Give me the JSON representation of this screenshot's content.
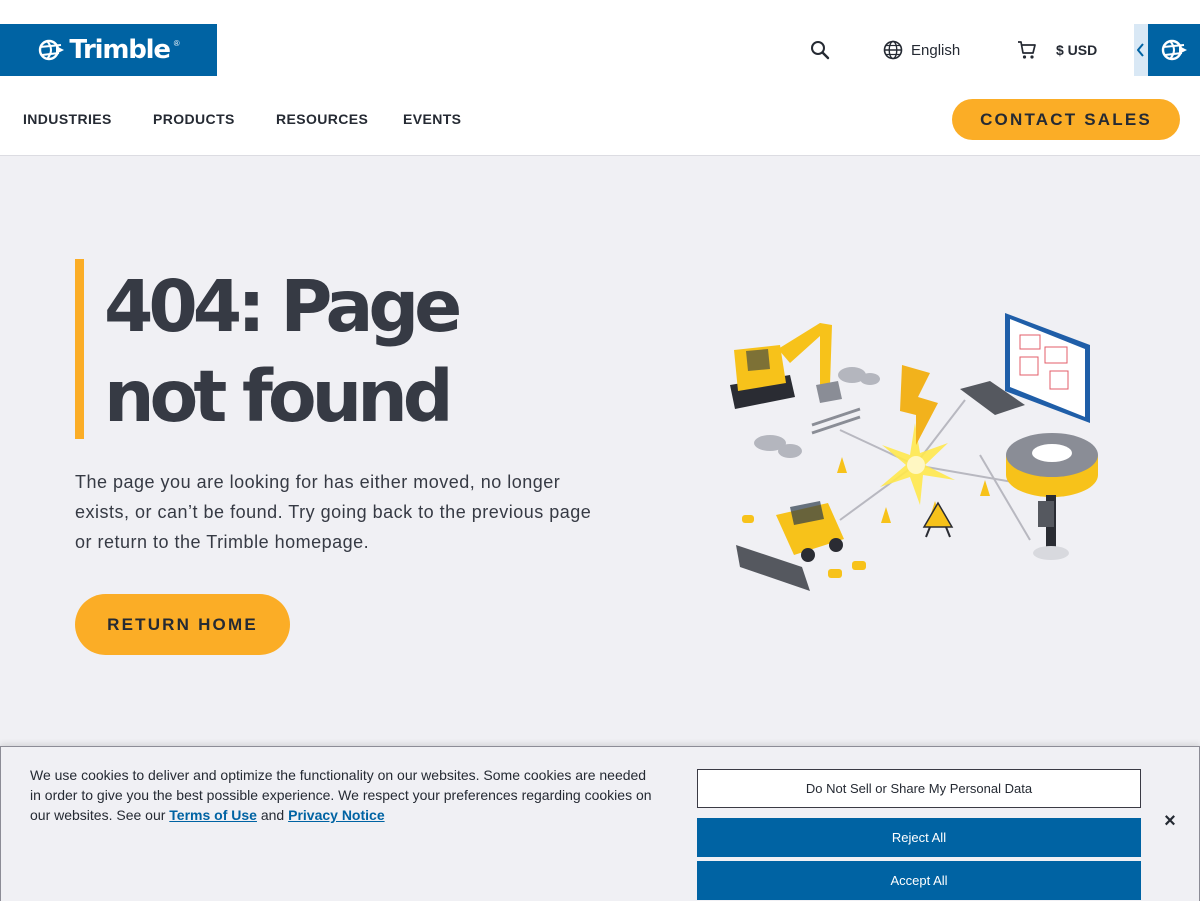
{
  "header": {
    "logo_text": "Trimble",
    "search_icon": "search-icon",
    "language": "English",
    "currency": "$ USD",
    "nav": [
      "INDUSTRIES",
      "PRODUCTS",
      "RESOURCES",
      "EVENTS"
    ],
    "contact_label": "CONTACT SALES"
  },
  "main": {
    "title_line1": "404: Page",
    "title_line2": "not found",
    "description": "The page you are looking for has either moved, no longer exists, or can’t be found. Try going back to the previous page or return to the Trimble homepage.",
    "return_label": "RETURN HOME"
  },
  "cookie": {
    "text": "We use cookies to deliver and optimize the functionality on our websites. Some cookies are needed in order to give you the best possible experience. We respect your preferences regarding cookies on our websites. See our",
    "terms_label": "Terms of Use",
    "and_text": "and",
    "privacy_label": "Privacy Notice",
    "do_not_sell_label": "Do Not Sell or Share My Personal Data",
    "reject_label": "Reject All",
    "accept_label": "Accept All",
    "close_label": "×"
  },
  "colors": {
    "brand_blue": "#0063a3",
    "accent_yellow": "#fbad26",
    "text_dark": "#252a33",
    "background": "#f0f0f4"
  }
}
